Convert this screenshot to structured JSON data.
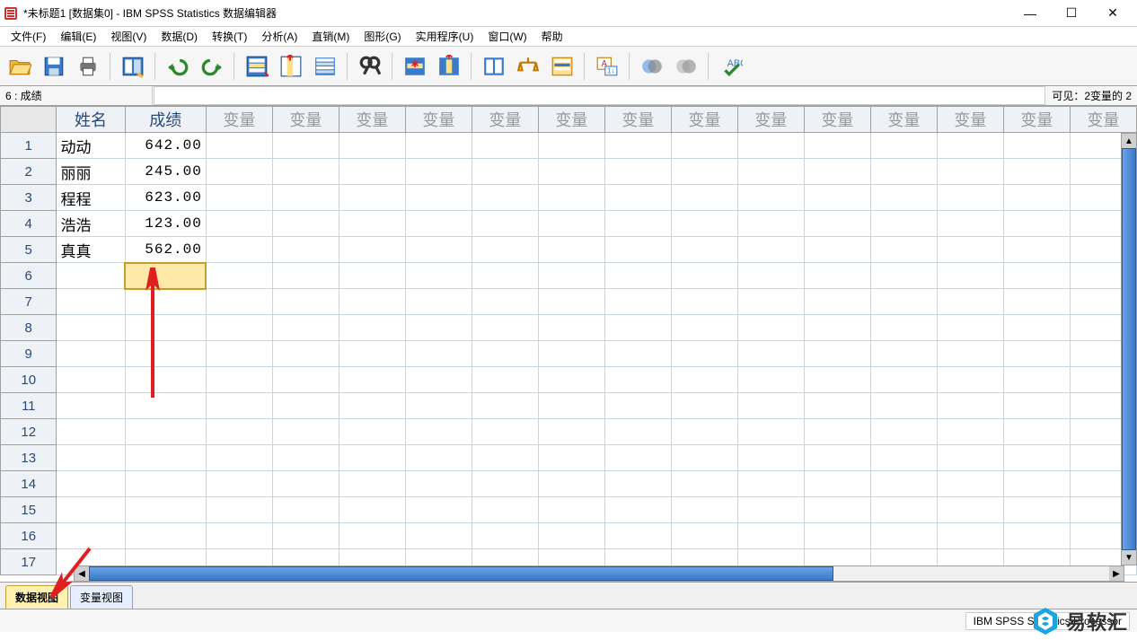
{
  "window": {
    "title": "*未标题1 [数据集0] - IBM SPSS Statistics 数据编辑器",
    "min_glyph": "—",
    "max_glyph": "☐",
    "close_glyph": "✕"
  },
  "menubar": [
    "文件(F)",
    "编辑(E)",
    "视图(V)",
    "数据(D)",
    "转换(T)",
    "分析(A)",
    "直销(M)",
    "图形(G)",
    "实用程序(U)",
    "窗口(W)",
    "帮助"
  ],
  "toolbar": {
    "buttons": [
      "open",
      "save",
      "print",
      "data-props",
      "undo",
      "redo",
      "goto-case",
      "goto-var",
      "variables",
      "find",
      "insert-case",
      "insert-var",
      "split-file",
      "weight",
      "select-cases",
      "value-labels",
      "use-sets",
      "spell-check"
    ]
  },
  "infobar": {
    "cell_ref": "6 : 成绩",
    "visible_label": "可见：2变量的 2"
  },
  "columns": {
    "named": [
      "姓名",
      "成绩"
    ],
    "empty_label": "变量",
    "empty_count": 14
  },
  "rows": {
    "count": 17,
    "data": [
      {
        "姓名": "动动",
        "成绩": "642.00"
      },
      {
        "姓名": "丽丽",
        "成绩": "245.00"
      },
      {
        "姓名": "程程",
        "成绩": "623.00"
      },
      {
        "姓名": "浩浩",
        "成绩": "123.00"
      },
      {
        "姓名": "真真",
        "成绩": "562.00"
      }
    ],
    "selected": {
      "row": 6,
      "col": "成绩"
    }
  },
  "view_tabs": {
    "active": "数据视图",
    "tabs": [
      "数据视图",
      "变量视图"
    ]
  },
  "statusbar": {
    "processor": "IBM SPSS Statistics Processor"
  },
  "watermark": {
    "text": "易软汇"
  }
}
